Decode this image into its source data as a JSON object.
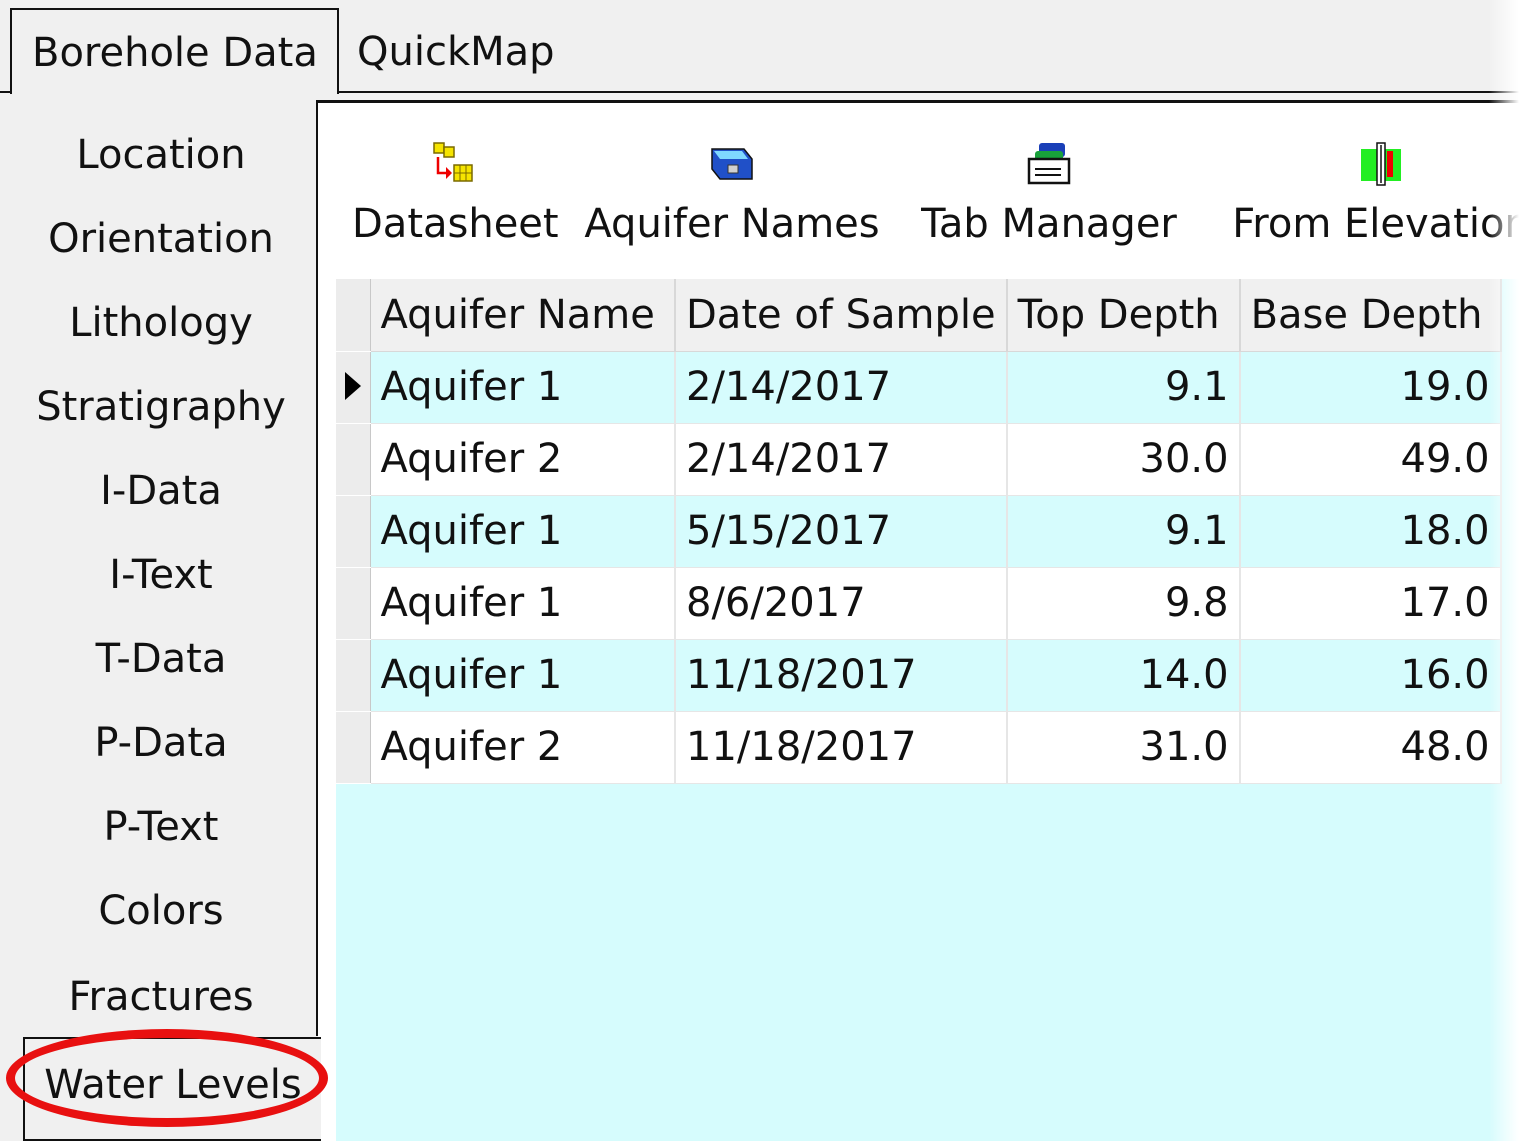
{
  "top_tabs": [
    {
      "label": "Borehole Data",
      "active": true
    },
    {
      "label": "QuickMap",
      "active": false
    }
  ],
  "side_tabs": [
    {
      "label": "Location"
    },
    {
      "label": "Orientation"
    },
    {
      "label": "Lithology"
    },
    {
      "label": "Stratigraphy"
    },
    {
      "label": "I-Data"
    },
    {
      "label": "I-Text"
    },
    {
      "label": "T-Data"
    },
    {
      "label": "P-Data"
    },
    {
      "label": "P-Text"
    },
    {
      "label": "Colors"
    },
    {
      "label": "Fractures"
    },
    {
      "label": "Water Levels",
      "active": true
    }
  ],
  "toolbar": [
    {
      "label": "Datasheet",
      "icon": "datasheet-icon"
    },
    {
      "label": "Aquifer Names",
      "icon": "aquifer-names-icon"
    },
    {
      "label": "Tab Manager",
      "icon": "tab-manager-icon"
    },
    {
      "label": "From Elevation",
      "icon": "from-elevation-icon"
    }
  ],
  "grid": {
    "columns": [
      "Aquifer Name",
      "Date of Sample",
      "Top Depth",
      "Base Depth"
    ],
    "rows": [
      [
        "Aquifer 1",
        "2/14/2017",
        "9.1",
        "19.0"
      ],
      [
        "Aquifer 2",
        "2/14/2017",
        "30.0",
        "49.0"
      ],
      [
        "Aquifer 1",
        "5/15/2017",
        "9.1",
        "18.0"
      ],
      [
        "Aquifer 1",
        "8/6/2017",
        "9.8",
        "17.0"
      ],
      [
        "Aquifer 1",
        "11/18/2017",
        "14.0",
        "16.0"
      ],
      [
        "Aquifer 2",
        "11/18/2017",
        "31.0",
        "48.0"
      ]
    ],
    "current_row": 0
  },
  "colors": {
    "grid_background": "#d6fcfd",
    "highlight": "#e81010"
  }
}
